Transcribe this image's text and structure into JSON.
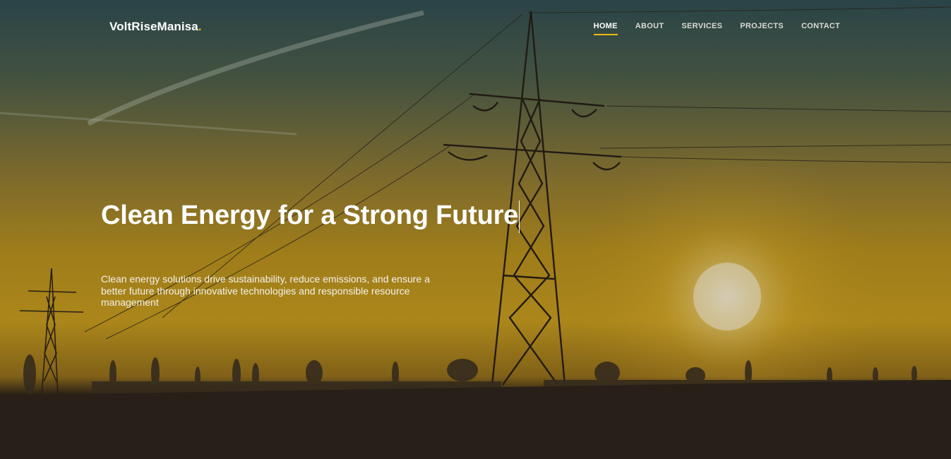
{
  "brand": {
    "name": "VoltRiseManisa",
    "dot": "."
  },
  "nav": {
    "items": [
      {
        "label": "HOME",
        "active": true
      },
      {
        "label": "ABOUT",
        "active": false
      },
      {
        "label": "SERVICES",
        "active": false
      },
      {
        "label": "PROJECTS",
        "active": false
      },
      {
        "label": "CONTACT",
        "active": false
      }
    ]
  },
  "hero": {
    "headline": "Clean Energy for a Strong Future",
    "description": "Clean energy solutions drive sustainability, reduce emissions, and ensure a better future through innovative technologies and responsible resource management"
  },
  "colors": {
    "accent": "#f0b90b",
    "text": "#ffffff"
  }
}
